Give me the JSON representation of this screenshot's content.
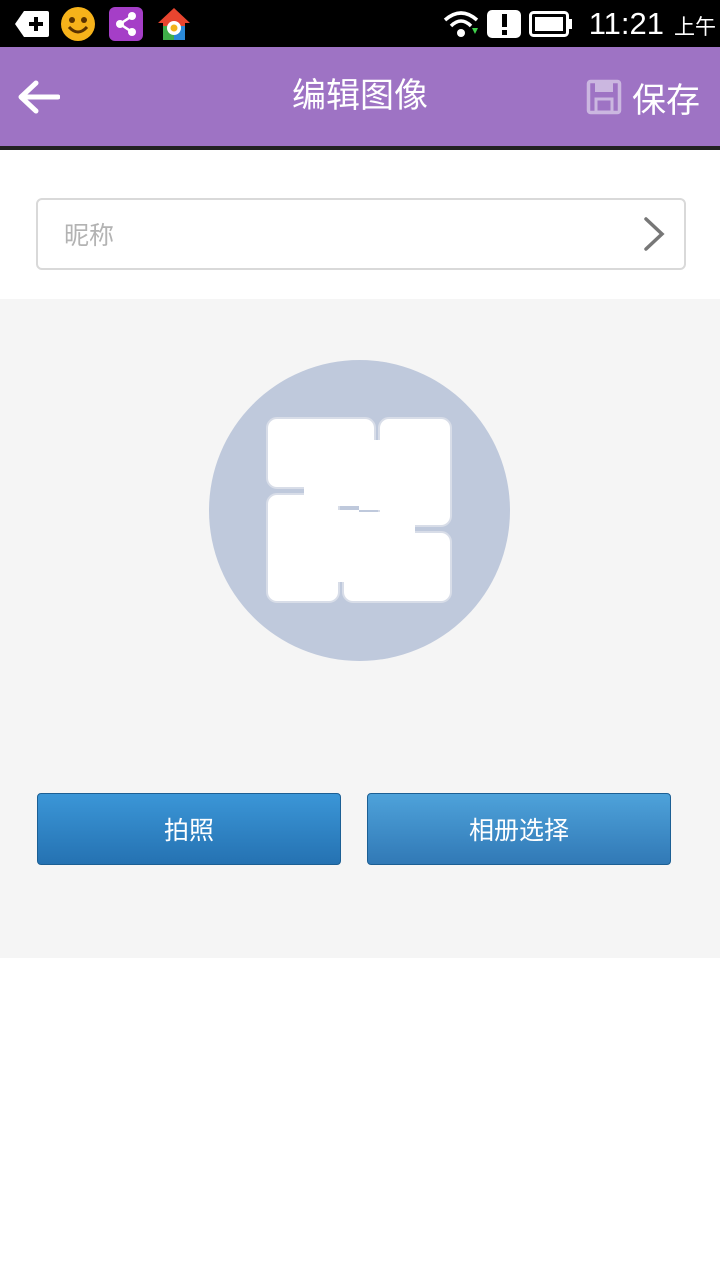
{
  "status_bar": {
    "time": "11:21",
    "ampm": "上午",
    "icons": [
      "add-icon",
      "smiley-icon",
      "share-icon",
      "home-gear-icon",
      "wifi-icon",
      "alert-icon",
      "battery-icon"
    ]
  },
  "app_bar": {
    "title": "编辑图像",
    "save_label": "保存",
    "icons": [
      "back-arrow-icon",
      "save-disk-icon"
    ],
    "color": "#9e73c4"
  },
  "nickname": {
    "placeholder": "昵称",
    "value": ""
  },
  "avatar": {
    "description_icon": "four-hands-icon",
    "background": "#bfc9dc"
  },
  "buttons": {
    "camera_label": "拍照",
    "album_label": "相册选择",
    "color": "#2f86c8"
  }
}
